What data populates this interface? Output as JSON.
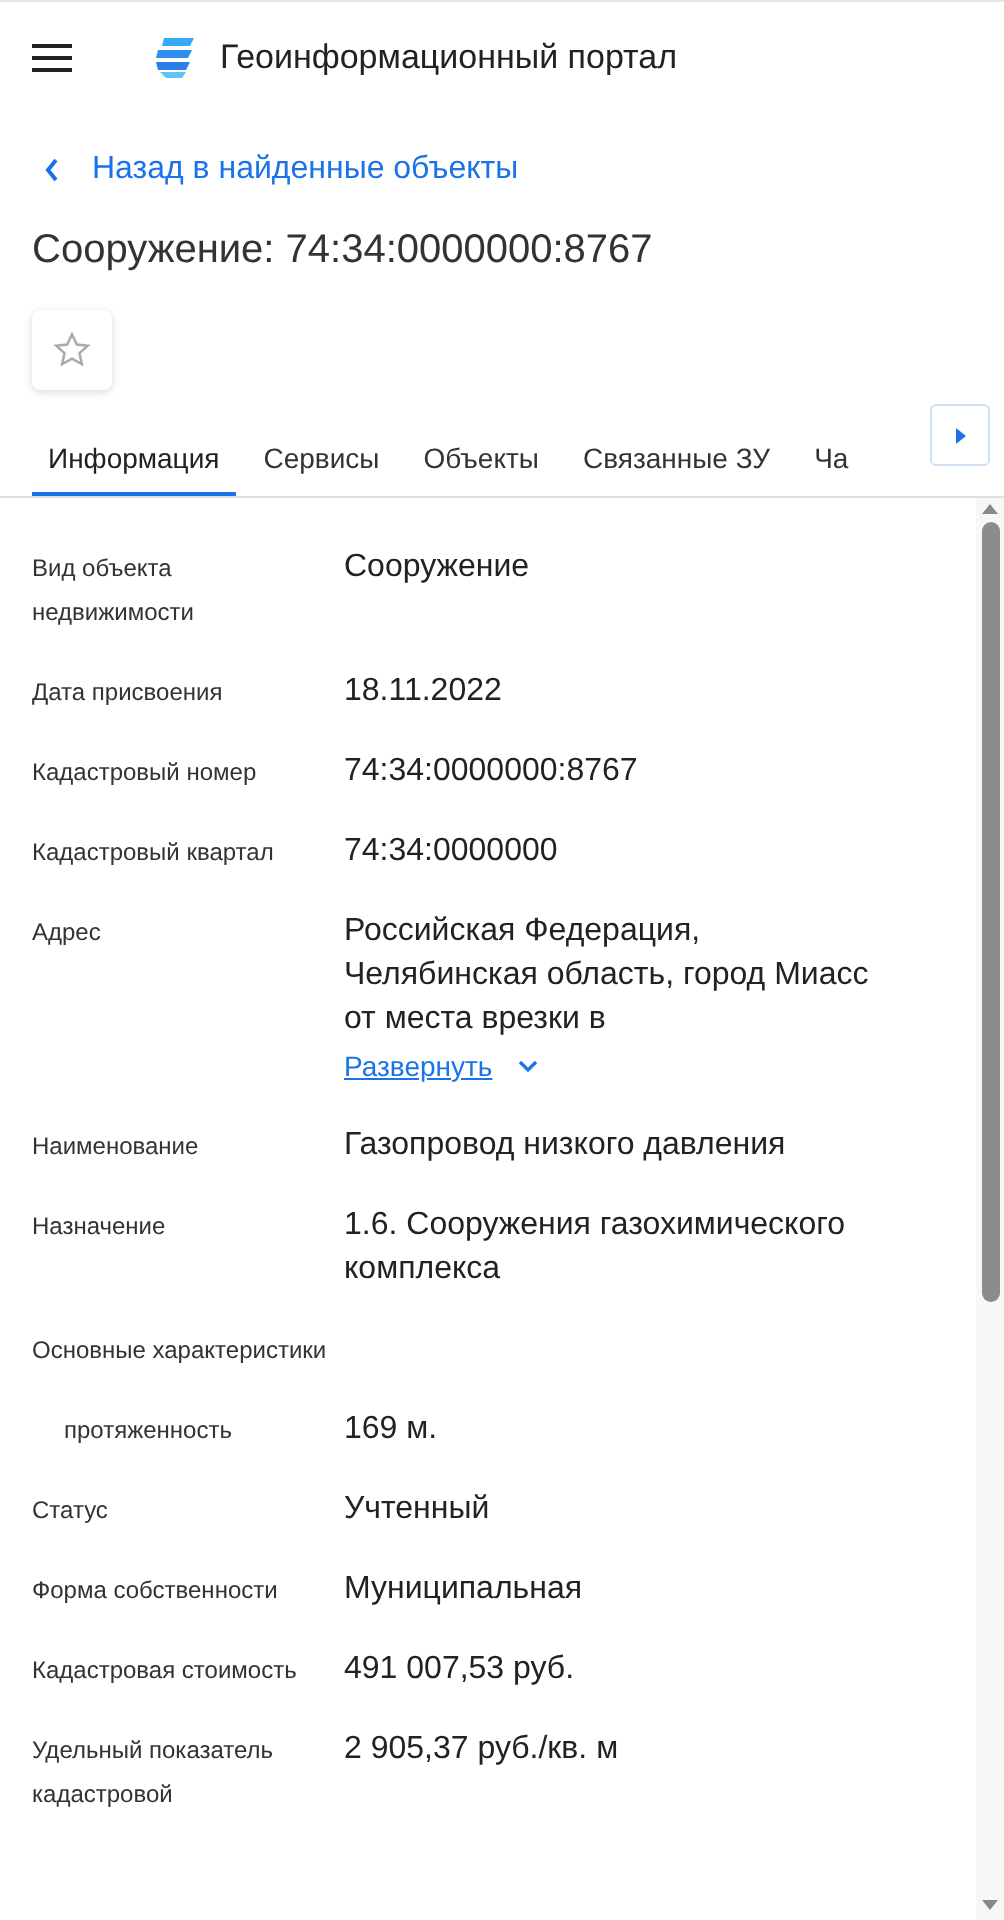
{
  "header": {
    "title": "Геоинформационный портал"
  },
  "back_link": "Назад в найденные объекты",
  "title": "Сооружение: 74:34:0000000:8767",
  "favorite": {
    "on": false
  },
  "tabs": [
    {
      "label": "Информация",
      "selected": true
    },
    {
      "label": "Сервисы",
      "selected": false
    },
    {
      "label": "Объекты",
      "selected": false
    },
    {
      "label": "Связанные ЗУ",
      "selected": false
    },
    {
      "label": "Ча",
      "selected": false
    }
  ],
  "fields": [
    {
      "kind": "text",
      "label": "Вид объекта недвижимости",
      "value": "Сооружение"
    },
    {
      "kind": "text",
      "label": "Дата присвоения",
      "value": "18.11.2022"
    },
    {
      "kind": "text",
      "label": "Кадастровый номер",
      "value": "74:34:0000000:8767"
    },
    {
      "kind": "text",
      "label": "Кадастровый квартал",
      "value": "74:34:0000000"
    },
    {
      "kind": "expandable",
      "label": "Адрес",
      "lines": [
        "Российская Федерация,",
        "Челябинская область, город Миасс",
        "от места врезки в"
      ],
      "link": "Развернуть"
    },
    {
      "kind": "text",
      "label": "Наименование",
      "value": "Газопровод низкого давления"
    },
    {
      "kind": "text",
      "label": "Назначение",
      "value": "1.6. Сооружения газохимического комплекса"
    },
    {
      "kind": "section",
      "label": "Основные характеристики"
    },
    {
      "kind": "sub",
      "label": "протяженность",
      "value": "169 м."
    },
    {
      "kind": "text",
      "label": "Статус",
      "value": "Учтенный"
    },
    {
      "kind": "text",
      "label": "Форма собственности",
      "value": "Муниципальная"
    },
    {
      "kind": "text",
      "label": "Кадастровая стоимость",
      "value": "491 007,53 руб."
    },
    {
      "kind": "text",
      "label": "Удельный показатель кадастровой",
      "value": "2 905,37 руб./кв. м"
    }
  ]
}
